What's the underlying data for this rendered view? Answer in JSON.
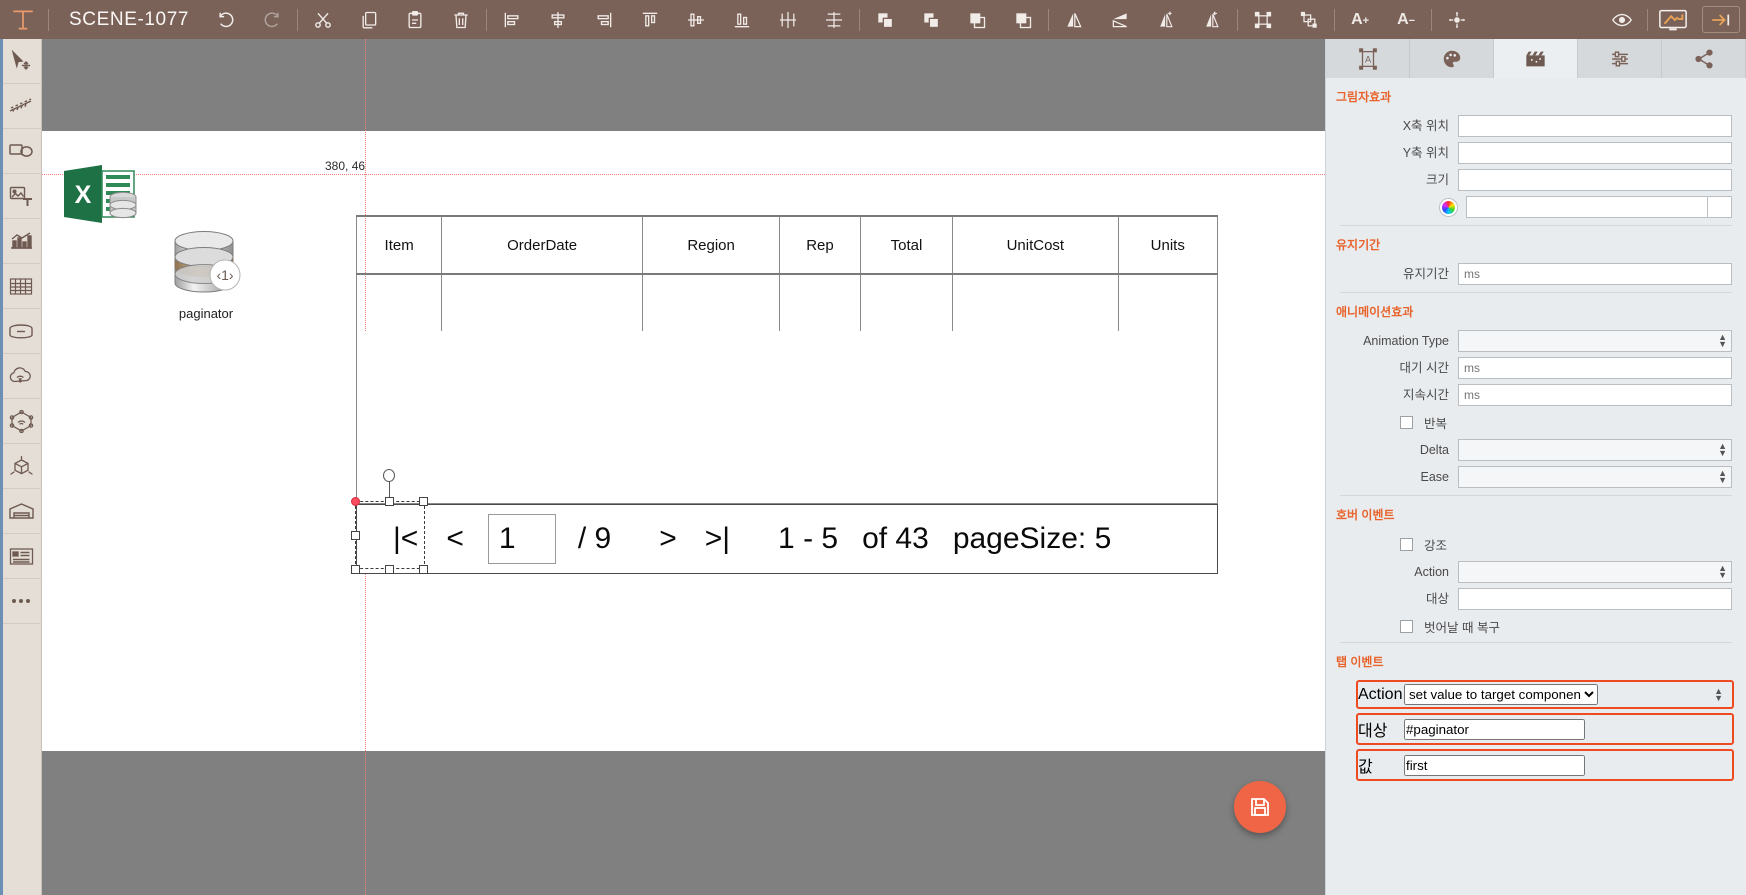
{
  "topbar": {
    "scene_title": "SCENE-1077",
    "icons": [
      {
        "name": "undo-icon",
        "dim": false
      },
      {
        "name": "redo-icon",
        "dim": true
      },
      {
        "name": "cut-icon",
        "dim": false
      },
      {
        "name": "copy-icon",
        "dim": false
      },
      {
        "name": "paste-icon",
        "dim": false
      },
      {
        "name": "delete-icon",
        "dim": false
      },
      {
        "name": "align-left-icon",
        "dim": false
      },
      {
        "name": "align-center-horizontal-icon",
        "dim": false
      },
      {
        "name": "align-right-icon",
        "dim": false
      },
      {
        "name": "align-top-icon",
        "dim": false
      },
      {
        "name": "align-middle-vertical-icon",
        "dim": false
      },
      {
        "name": "align-bottom-icon",
        "dim": false
      },
      {
        "name": "distribute-horizontal-icon",
        "dim": false
      },
      {
        "name": "distribute-vertical-icon",
        "dim": false
      },
      {
        "name": "bring-to-front-icon",
        "dim": false
      },
      {
        "name": "bring-forward-icon",
        "dim": false
      },
      {
        "name": "send-backward-icon",
        "dim": false
      },
      {
        "name": "send-to-back-icon",
        "dim": false
      },
      {
        "name": "flip-horizontal-icon",
        "dim": false
      },
      {
        "name": "flip-vertical-icon",
        "dim": false
      },
      {
        "name": "rotate-left-icon",
        "dim": false
      },
      {
        "name": "rotate-right-icon",
        "dim": false
      },
      {
        "name": "group-icon",
        "dim": false
      },
      {
        "name": "ungroup-icon",
        "dim": false
      }
    ],
    "font_increase_label": "A",
    "font_increase_sup": "+",
    "font_decrease_label": "A",
    "font_decrease_sup": "−",
    "move-icon": "move-icon",
    "preview_icon": "eye-icon",
    "monitor_icon": "monitor-icon",
    "collapse_icon": "collapse-panel-icon"
  },
  "rail": {
    "items": [
      {
        "name": "select-tool",
        "icon": "cursor-move-icon"
      },
      {
        "name": "line-tool",
        "icon": "ruler-line-icon"
      },
      {
        "name": "shape-tool",
        "icon": "shapes-icon"
      },
      {
        "name": "image-text-tool",
        "icon": "image-text-icon"
      },
      {
        "name": "chart-tool",
        "icon": "chart-bar-icon"
      },
      {
        "name": "table-tool",
        "icon": "table-grid-icon"
      },
      {
        "name": "container-tool",
        "icon": "box-icon"
      },
      {
        "name": "cloud-tool",
        "icon": "cloud-wifi-icon"
      },
      {
        "name": "network-tool",
        "icon": "network-sensor-icon"
      },
      {
        "name": "3d-tool",
        "icon": "cube-3d-icon"
      },
      {
        "name": "facility-tool",
        "icon": "warehouse-icon"
      },
      {
        "name": "layout-tool",
        "icon": "layout-panel-icon"
      },
      {
        "name": "more-tool",
        "icon": "ellipsis-icon"
      }
    ]
  },
  "canvas": {
    "coordinate_label": "380, 46",
    "excel_node": {
      "label": "",
      "icon": "excel-database-icon"
    },
    "paginator_node": {
      "label": "paginator",
      "badge": "1",
      "icon": "database-cylinder-icon"
    },
    "table": {
      "headers": [
        "Item",
        "OrderDate",
        "Region",
        "Rep",
        "Total",
        "UnitCost",
        "Units"
      ],
      "rows": [
        [
          "",
          "",
          "",
          "",
          "",
          "",
          ""
        ]
      ]
    },
    "paginator_bar": {
      "first_label": "|<",
      "prev_label": "<",
      "page_value": "1",
      "total_pages_label": "/ 9",
      "next_label": ">",
      "last_label": ">|",
      "range_label": "1  -  5",
      "of_label": "of 43",
      "page_size_label": "pageSize: 5"
    }
  },
  "panel": {
    "tabs": [
      {
        "name": "tab-properties",
        "icon": "selection-text-icon",
        "active": false
      },
      {
        "name": "tab-style",
        "icon": "palette-icon",
        "active": false
      },
      {
        "name": "tab-animation",
        "icon": "clapperboard-icon",
        "active": true
      },
      {
        "name": "tab-settings",
        "icon": "sliders-icon",
        "active": false
      },
      {
        "name": "tab-share",
        "icon": "share-icon",
        "active": false
      }
    ],
    "shadow": {
      "title": "그림자효과",
      "x_label": "X축 위치",
      "x_value": "",
      "y_label": "Y축 위치",
      "y_value": "",
      "size_label": "크기",
      "size_value": "",
      "color_value": ""
    },
    "duration": {
      "title": "유지기간",
      "label": "유지기간",
      "placeholder": "ms",
      "value": ""
    },
    "animation": {
      "title": "애니메이션효과",
      "type_label": "Animation Type",
      "type_value": "",
      "delay_label": "대기 시간",
      "delay_placeholder": "ms",
      "delay_value": "",
      "duration_label": "지속시간",
      "duration_placeholder": "ms",
      "duration_value": "",
      "repeat_label": "반복",
      "repeat_checked": false,
      "delta_label": "Delta",
      "delta_value": "",
      "ease_label": "Ease",
      "ease_value": ""
    },
    "hover_event": {
      "title": "호버 이벤트",
      "emphasis_label": "강조",
      "emphasis_checked": false,
      "action_label": "Action",
      "action_value": "",
      "target_label": "대상",
      "target_value": "",
      "restore_label": "벗어날 때 복구",
      "restore_checked": false
    },
    "tap_event": {
      "title": "탭 이벤트",
      "action_label": "Action",
      "action_value": "set value to target componen",
      "target_label": "대상",
      "target_value": "#paginator",
      "value_label": "값",
      "value_value": "first"
    }
  },
  "colors": {
    "topbar_bg": "#7a6259",
    "accent_orange": "#e8642c",
    "highlight_red": "#ef4b23",
    "fab": "#ef6546",
    "guide": "#ef7f77",
    "panel_bg": "#e9ecef"
  }
}
